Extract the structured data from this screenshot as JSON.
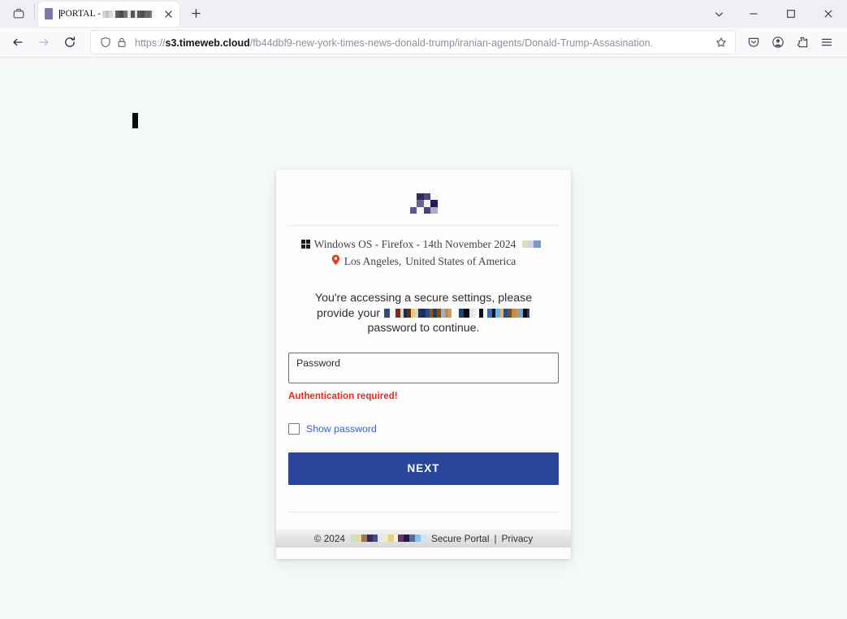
{
  "browser": {
    "name": "firefox",
    "tab": {
      "title_visible": "PORTAL -",
      "title_redacted": true,
      "close_label": "×",
      "favicon": "portal-favicon"
    },
    "newtab_label": "+",
    "toolbar": {
      "firefox_view_icon": "firefox-view-icon",
      "back_icon": "back-arrow-icon",
      "forward_icon": "forward-arrow-icon",
      "reload_icon": "reload-icon",
      "shield_icon": "shield-icon",
      "lock_icon": "padlock-icon",
      "star_icon": "bookmark-star-icon",
      "pocket_icon": "save-to-pocket-icon",
      "account_icon": "account-icon",
      "extensions_icon": "extensions-icon",
      "menu_icon": "hamburger-menu-icon"
    },
    "window_controls": {
      "list_all_tabs": "list-all-tabs-icon",
      "minimize": "minimize-icon",
      "maximize": "maximize-icon",
      "close": "close-icon"
    },
    "url": {
      "scheme": "https://",
      "host": "s3.timeweb.cloud",
      "path": "/fb44dbf9-new-york-times-news-donald-trump/iranian-agents/Donald-Trump-Assasination.",
      "full": "https://s3.timeweb.cloud/fb44dbf9-new-york-times-news-donald-trump/iranian-agents/Donald-Trump-Assasination."
    }
  },
  "page": {
    "background_color": "#f5f9f6",
    "card_background": "#fbfcfb",
    "logo_name": "portal-logo-pixelated",
    "device_line": {
      "os_icon": "windows-logo-icon",
      "text": "Windows OS - Firefox - 14th November 2024",
      "trailing_redacted": true
    },
    "location_line": {
      "pin_icon": "location-pin-icon",
      "city": "Los Angeles,",
      "country": "United States of America"
    },
    "message": {
      "part1": "You're accessing a secure settings, please provide your",
      "redacted": true,
      "part2": "password to continue."
    },
    "password_field": {
      "label": "Password",
      "value": "",
      "placeholder": "Password"
    },
    "error": "Authentication required!",
    "show_password": {
      "label": "Show password",
      "checked": false,
      "link_color": "#3b62c4"
    },
    "next_button": {
      "label": "NEXT",
      "color": "#28479c"
    },
    "footer": {
      "copyright": "© 2024",
      "redacted": true,
      "link_portal": "Secure Portal",
      "separator": "|",
      "link_privacy": "Privacy"
    }
  },
  "redactions": {
    "tab_blocks": [
      {
        "w": 4,
        "c": "#d4d4d4"
      },
      {
        "w": 4,
        "c": "#c3c3c3"
      },
      {
        "w": 5,
        "c": "#dadada"
      },
      {
        "w": 3,
        "c": "#f0f0f0"
      },
      {
        "w": 5,
        "c": "#5e5e5e"
      },
      {
        "w": 5,
        "c": "#4b4b4b"
      },
      {
        "w": 5,
        "c": "#6f6f6f"
      },
      {
        "w": 4,
        "c": "#e4e4e4"
      },
      {
        "w": 5,
        "c": "#565656"
      },
      {
        "w": 3,
        "c": "#e0e0e0"
      },
      {
        "w": 4,
        "c": "#5a5a5a"
      },
      {
        "w": 5,
        "c": "#4f4f4f"
      },
      {
        "w": 5,
        "c": "#6a6a6a"
      },
      {
        "w": 4,
        "c": "#5d5d5d"
      },
      {
        "w": 3,
        "c": "#eeeeee"
      },
      {
        "w": 4,
        "c": "#f4f4f4"
      }
    ],
    "date_badge": [
      {
        "w": 7,
        "c": "#e3dcbb"
      },
      {
        "w": 7,
        "c": "#cdd5e2"
      },
      {
        "w": 9,
        "c": "#7f97c8"
      },
      {
        "w": 6,
        "c": "#fbfbf0"
      }
    ],
    "message_blocks": [
      {
        "w": 7,
        "c": "#2e4f77"
      },
      {
        "w": 4,
        "c": "#f7f6ee"
      },
      {
        "w": 3,
        "c": "#fafaf2"
      },
      {
        "w": 6,
        "c": "#7a2b22"
      },
      {
        "w": 4,
        "c": "#cfd8c6"
      },
      {
        "w": 4,
        "c": "#1d2a55"
      },
      {
        "w": 5,
        "c": "#5a3317"
      },
      {
        "w": 5,
        "c": "#e5c987"
      },
      {
        "w": 4,
        "c": "#d8dcb5"
      },
      {
        "w": 4,
        "c": "#222f6b"
      },
      {
        "w": 5,
        "c": "#1f2d5e"
      },
      {
        "w": 5,
        "c": "#2d4a86"
      },
      {
        "w": 4,
        "c": "#8f5a20"
      },
      {
        "w": 5,
        "c": "#243a6d"
      },
      {
        "w": 5,
        "c": "#7f4c1e"
      },
      {
        "w": 5,
        "c": "#9fb2c4"
      },
      {
        "w": 4,
        "c": "#b98e4e"
      },
      {
        "w": 4,
        "c": "#c6a272"
      },
      {
        "w": 9,
        "c": "#fafaf4"
      },
      {
        "w": 6,
        "c": "#20406e"
      },
      {
        "w": 7,
        "c": "#0c0c0c"
      },
      {
        "w": 5,
        "c": "#dfe4ee"
      },
      {
        "w": 4,
        "c": "#f2f0e6"
      },
      {
        "w": 3,
        "c": "#fafaf4"
      },
      {
        "w": 5,
        "c": "#0b1020"
      },
      {
        "w": 5,
        "c": "#f6f6ee"
      },
      {
        "w": 6,
        "c": "#3a6ea8"
      },
      {
        "w": 4,
        "c": "#12121c"
      },
      {
        "w": 6,
        "c": "#6fb0e0"
      },
      {
        "w": 4,
        "c": "#e8b35e"
      },
      {
        "w": 5,
        "c": "#2a4b8c"
      },
      {
        "w": 5,
        "c": "#7f4c1e"
      },
      {
        "w": 5,
        "c": "#b98e4e"
      },
      {
        "w": 4,
        "c": "#c09a63"
      },
      {
        "w": 5,
        "c": "#6fa8d8"
      },
      {
        "w": 5,
        "c": "#0a0a12"
      },
      {
        "w": 3,
        "c": "#1f3f6e"
      }
    ],
    "footer_blocks": [
      {
        "w": 7,
        "c": "#cfe0c4"
      },
      {
        "w": 7,
        "c": "#e2d9a5"
      },
      {
        "w": 7,
        "c": "#9a7a52"
      },
      {
        "w": 7,
        "c": "#3b2a55"
      },
      {
        "w": 6,
        "c": "#4a4a8a"
      },
      {
        "w": 6,
        "c": "#dfe7ef"
      },
      {
        "w": 7,
        "c": "#efeccd"
      },
      {
        "w": 7,
        "c": "#e7cf8a"
      },
      {
        "w": 5,
        "c": "#f4f3e6"
      },
      {
        "w": 7,
        "c": "#5a3a62"
      },
      {
        "w": 7,
        "c": "#231a42"
      },
      {
        "w": 7,
        "c": "#5a6a9a"
      },
      {
        "w": 7,
        "c": "#8fbde8"
      },
      {
        "w": 7,
        "c": "#cfe2f2"
      }
    ],
    "logo_pixels": [
      "#fbfcfb",
      "#fbfcfb",
      "#fbfcfb",
      "#fbfcfb",
      "#fbfcfb",
      "#322a5e",
      "#4b4480",
      "#fbfcfb",
      "#fbfcfb",
      "#6a6398",
      "#f2eef2",
      "#231c52",
      "#5d5690",
      "#fbfcfb",
      "#4a4478",
      "#aeaac8",
      "#fbfcfb",
      "#4b4478",
      "#2b2356",
      "#fbfcfb"
    ]
  }
}
